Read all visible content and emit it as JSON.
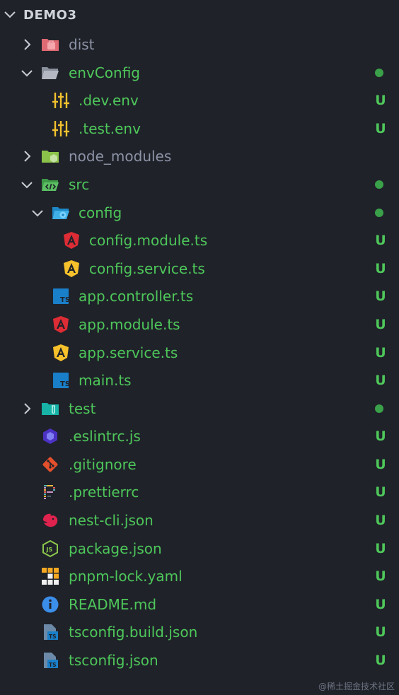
{
  "explorer": {
    "root_title": "DEMO3",
    "colors": {
      "modified": "#4ec75a",
      "ignored": "#8d93a6",
      "background": "#1f2229"
    },
    "items": [
      {
        "name": "dist",
        "kind": "folder",
        "icon": "dist-folder-icon",
        "expanded": false,
        "status": ""
      },
      {
        "name": "envConfig",
        "kind": "folder",
        "icon": "folder-open-icon",
        "expanded": true,
        "status": "dot"
      },
      {
        "name": ".dev.env",
        "kind": "file",
        "icon": "env-settings-icon",
        "status": "U"
      },
      {
        "name": ".test.env",
        "kind": "file",
        "icon": "env-settings-icon",
        "status": "U"
      },
      {
        "name": "node_modules",
        "kind": "folder",
        "icon": "node-folder-icon",
        "expanded": false,
        "status": ""
      },
      {
        "name": "src",
        "kind": "folder",
        "icon": "src-folder-icon",
        "expanded": true,
        "status": "dot"
      },
      {
        "name": "config",
        "kind": "folder",
        "icon": "config-folder-icon",
        "expanded": true,
        "status": "dot"
      },
      {
        "name": "config.module.ts",
        "kind": "file",
        "icon": "angular-module-icon",
        "status": "U"
      },
      {
        "name": "config.service.ts",
        "kind": "file",
        "icon": "angular-service-icon",
        "status": "U"
      },
      {
        "name": "app.controller.ts",
        "kind": "file",
        "icon": "typescript-icon",
        "status": "U"
      },
      {
        "name": "app.module.ts",
        "kind": "file",
        "icon": "angular-module-icon",
        "status": "U"
      },
      {
        "name": "app.service.ts",
        "kind": "file",
        "icon": "angular-service-icon",
        "status": "U"
      },
      {
        "name": "main.ts",
        "kind": "file",
        "icon": "typescript-icon",
        "status": "U"
      },
      {
        "name": "test",
        "kind": "folder",
        "icon": "test-folder-icon",
        "expanded": false,
        "status": "dot"
      },
      {
        "name": ".eslintrc.js",
        "kind": "file",
        "icon": "eslint-icon",
        "status": "U"
      },
      {
        "name": ".gitignore",
        "kind": "file",
        "icon": "git-icon",
        "status": "U"
      },
      {
        "name": ".prettierrc",
        "kind": "file",
        "icon": "prettier-icon",
        "status": "U"
      },
      {
        "name": "nest-cli.json",
        "kind": "file",
        "icon": "nestjs-icon",
        "status": "U"
      },
      {
        "name": "package.json",
        "kind": "file",
        "icon": "nodejs-icon",
        "status": "U"
      },
      {
        "name": "pnpm-lock.yaml",
        "kind": "file",
        "icon": "pnpm-icon",
        "status": "U"
      },
      {
        "name": "README.md",
        "kind": "file",
        "icon": "info-icon",
        "status": "U"
      },
      {
        "name": "tsconfig.build.json",
        "kind": "file",
        "icon": "tsconfig-icon",
        "status": "U"
      },
      {
        "name": "tsconfig.json",
        "kind": "file",
        "icon": "tsconfig-icon",
        "status": "U"
      }
    ]
  },
  "watermark": "@稀土掘金技术社区"
}
